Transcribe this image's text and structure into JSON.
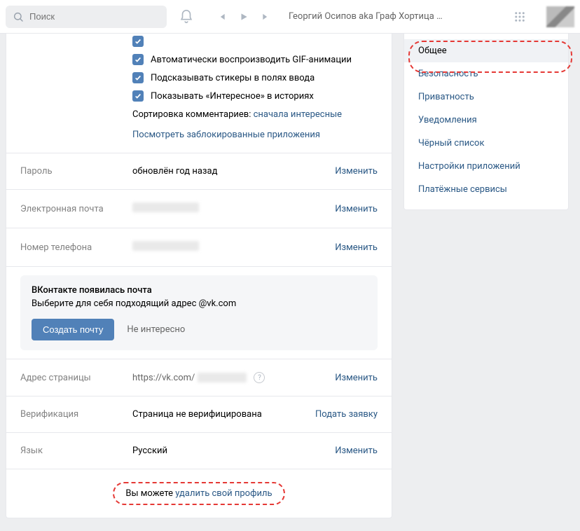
{
  "header": {
    "search_placeholder": "Поиск",
    "track_title": "Георгий Осипов aka Граф Хортица …"
  },
  "checkboxes": {
    "gif": "Автоматически воспроизводить GIF-анимации",
    "stickers": "Подсказывать стикеры в полях ввода",
    "interesting": "Показывать «Интересное» в историях"
  },
  "sort": {
    "prefix": "Сортировка комментариев: ",
    "value": "сначала интересные"
  },
  "blocked_apps_link": "Посмотреть заблокированные приложения",
  "rows": {
    "password": {
      "lbl": "Пароль",
      "val": "обновлён год назад",
      "act": "Изменить"
    },
    "email": {
      "lbl": "Электронная почта",
      "act": "Изменить"
    },
    "phone": {
      "lbl": "Номер телефона",
      "act": "Изменить"
    },
    "address": {
      "lbl": "Адрес страницы",
      "prefix": "https://vk.com/",
      "act": "Изменить"
    },
    "verify": {
      "lbl": "Верификация",
      "val": "Страница не верифицирована",
      "act": "Подать заявку"
    },
    "lang": {
      "lbl": "Язык",
      "val": "Русский",
      "act": "Изменить"
    }
  },
  "mail_promo": {
    "title": "ВКонтакте появилась почта",
    "subtitle": "Выберите для себя подходящий адрес @vk.com",
    "primary_btn": "Создать почту",
    "ghost_btn": "Не интересно"
  },
  "footer": {
    "prefix": "Вы можете ",
    "link": "удалить свой профиль"
  },
  "sidebar": {
    "items": [
      {
        "label": "Общее",
        "active": true
      },
      {
        "label": "Безопасность"
      },
      {
        "label": "Приватность"
      },
      {
        "label": "Уведомления"
      },
      {
        "label": "Чёрный список"
      },
      {
        "label": "Настройки приложений"
      },
      {
        "label": "Платёжные сервисы"
      }
    ]
  }
}
